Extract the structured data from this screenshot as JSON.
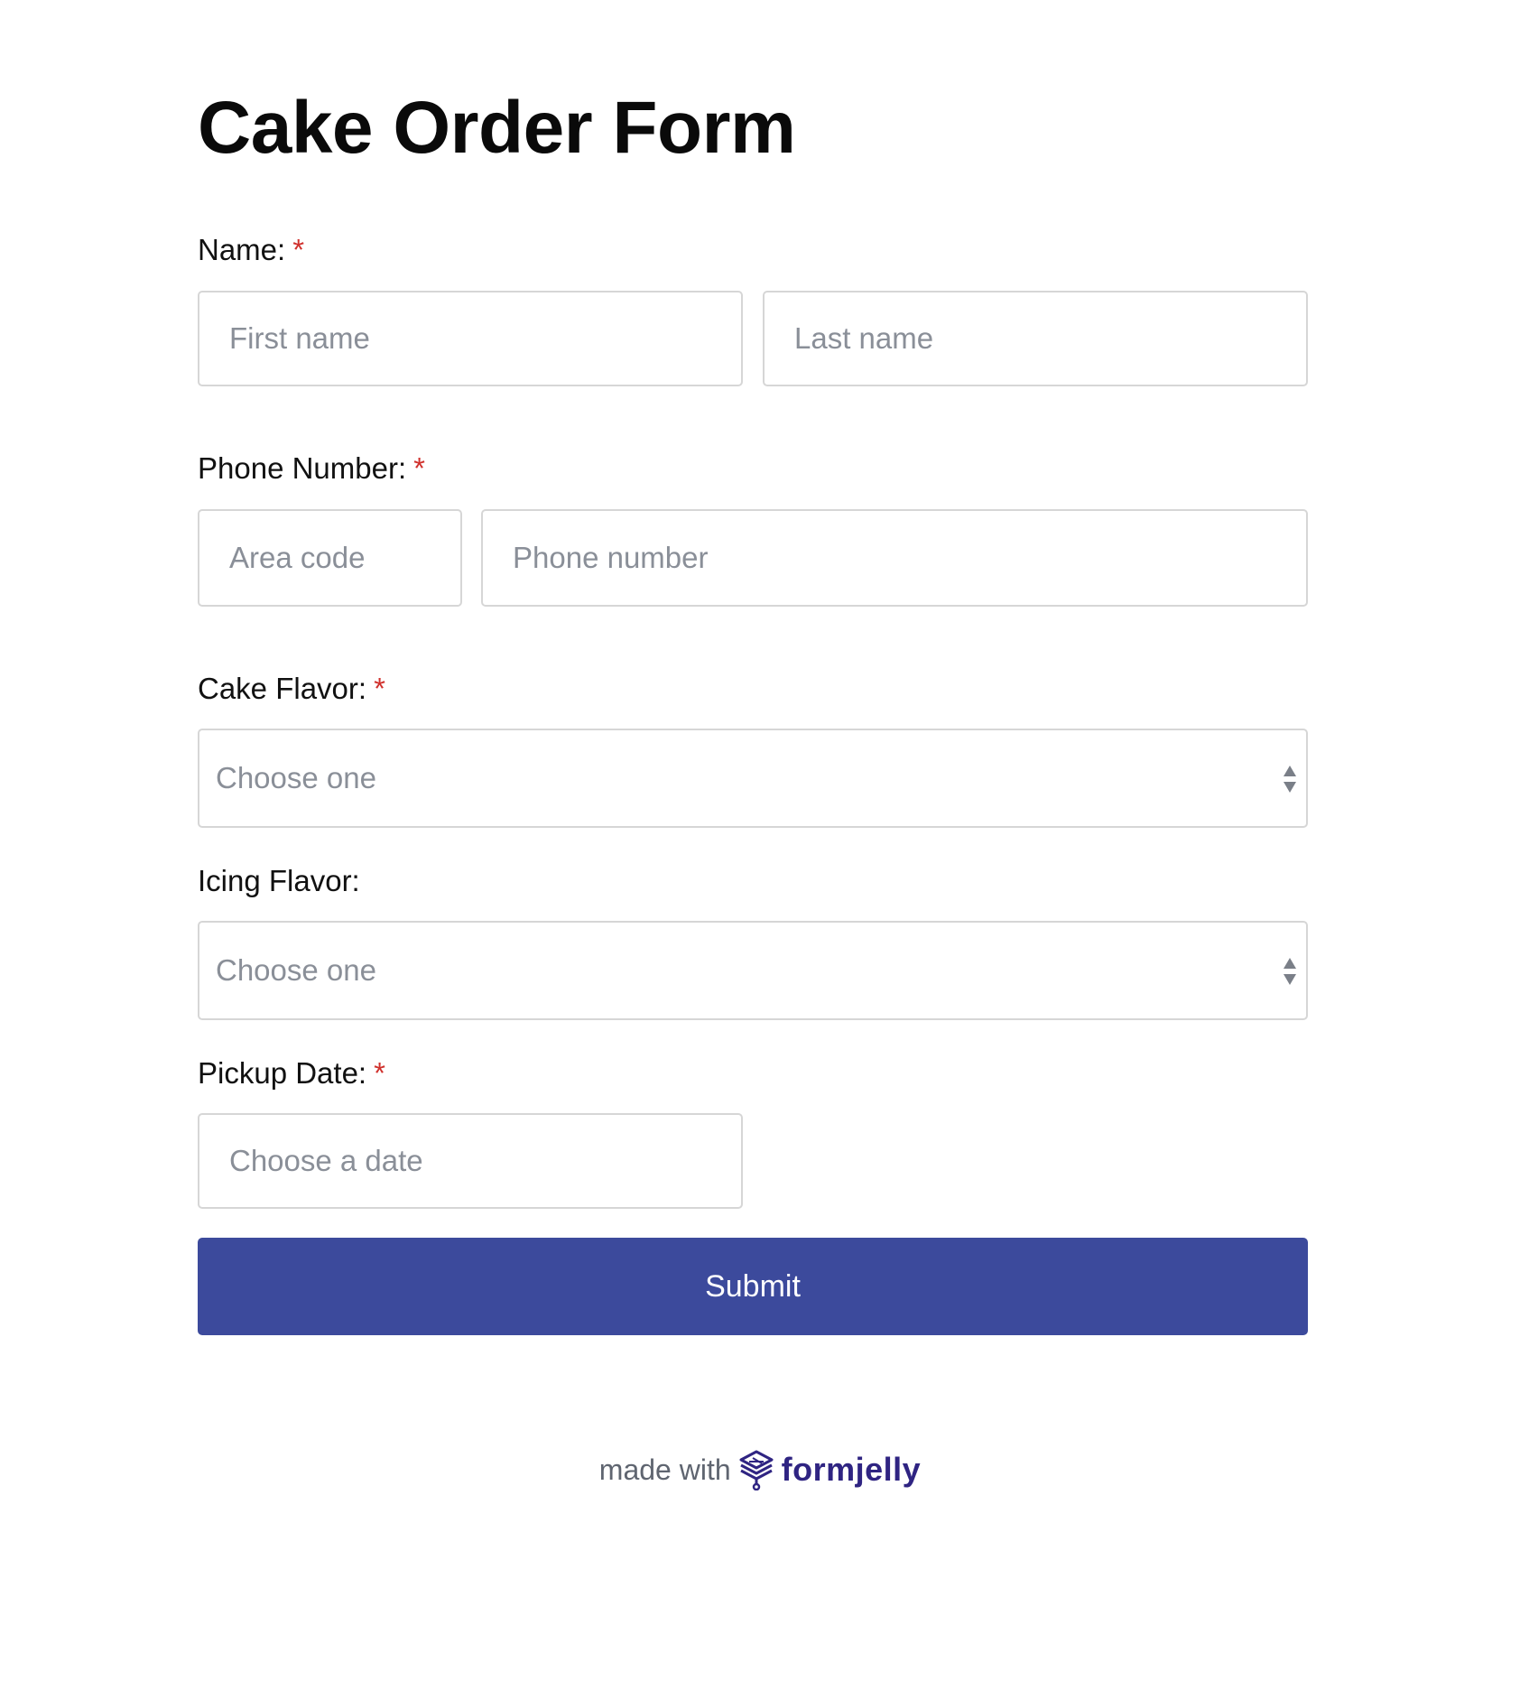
{
  "form": {
    "title": "Cake Order Form",
    "required_marker": "*",
    "name": {
      "label": "Name:",
      "first_placeholder": "First name",
      "last_placeholder": "Last name"
    },
    "phone": {
      "label": "Phone Number:",
      "area_placeholder": "Area code",
      "number_placeholder": "Phone number"
    },
    "cake_flavor": {
      "label": "Cake Flavor:",
      "selected": "Choose one"
    },
    "icing_flavor": {
      "label": "Icing Flavor:",
      "selected": "Choose one"
    },
    "pickup_date": {
      "label": "Pickup Date:",
      "placeholder": "Choose a date"
    },
    "submit_label": "Submit"
  },
  "footer": {
    "made_with": "made with",
    "brand": "formjelly",
    "brand_icon": "formjelly-logo-icon"
  },
  "colors": {
    "accent": "#3c4a9c",
    "required": "#d0312d",
    "brand": "#2f2482",
    "placeholder": "#8a8f98",
    "border": "#d6d6d6"
  }
}
